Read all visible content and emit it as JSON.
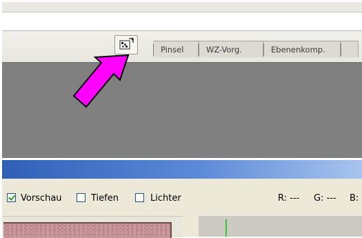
{
  "panel_tabs": [
    "Pinsel",
    "WZ-Vorg.",
    "Ebenenkomp."
  ],
  "dialog": {
    "checkboxes": [
      {
        "label": "Vorschau",
        "checked": true
      },
      {
        "label": "Tiefen",
        "checked": false
      },
      {
        "label": "Lichter",
        "checked": false
      }
    ],
    "readouts": {
      "r": "R: ---",
      "g": "G: ---",
      "b": "B:"
    }
  },
  "icons": {
    "palette_well": "palette-well-icon",
    "arrow": "pointer-arrow-annotation-icon"
  },
  "colors": {
    "arrow": "#ff00ff",
    "titlebar_blue": "#2f5fb8",
    "workspace_gray": "#808080"
  }
}
